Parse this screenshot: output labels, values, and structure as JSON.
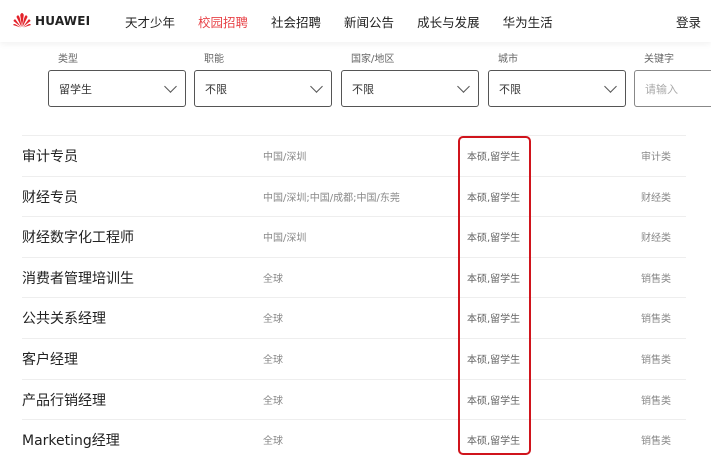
{
  "header": {
    "logo_text": "HUAWEI",
    "nav": [
      "天才少年",
      "校园招聘",
      "社会招聘",
      "新闻公告",
      "成长与发展",
      "华为生活"
    ],
    "active_index": 1,
    "login": "登录",
    "accent_color": "#e8454a"
  },
  "filters": [
    {
      "label": "类型",
      "value": "留学生"
    },
    {
      "label": "职能",
      "value": "不限"
    },
    {
      "label": "国家/地区",
      "value": "不限"
    },
    {
      "label": "城市",
      "value": "不限"
    },
    {
      "label": "关键字",
      "placeholder": "请输入"
    }
  ],
  "jobs": [
    {
      "name": "审计专员",
      "location": "中国/深圳",
      "degree": "本硕,留学生",
      "category": "审计类"
    },
    {
      "name": "财经专员",
      "location": "中国/深圳;中国/成都;中国/东莞",
      "degree": "本硕,留学生",
      "category": "财经类"
    },
    {
      "name": "财经数字化工程师",
      "location": "中国/深圳",
      "degree": "本硕,留学生",
      "category": "财经类"
    },
    {
      "name": "消费者管理培训生",
      "location": "全球",
      "degree": "本硕,留学生",
      "category": "销售类"
    },
    {
      "name": "公共关系经理",
      "location": "全球",
      "degree": "本硕,留学生",
      "category": "销售类"
    },
    {
      "name": "客户经理",
      "location": "全球",
      "degree": "本硕,留学生",
      "category": "销售类"
    },
    {
      "name": "产品行销经理",
      "location": "全球",
      "degree": "本硕,留学生",
      "category": "销售类"
    },
    {
      "name": "Marketing经理",
      "location": "全球",
      "degree": "本硕,留学生",
      "category": "销售类"
    }
  ],
  "highlight_color": "#d0141c"
}
